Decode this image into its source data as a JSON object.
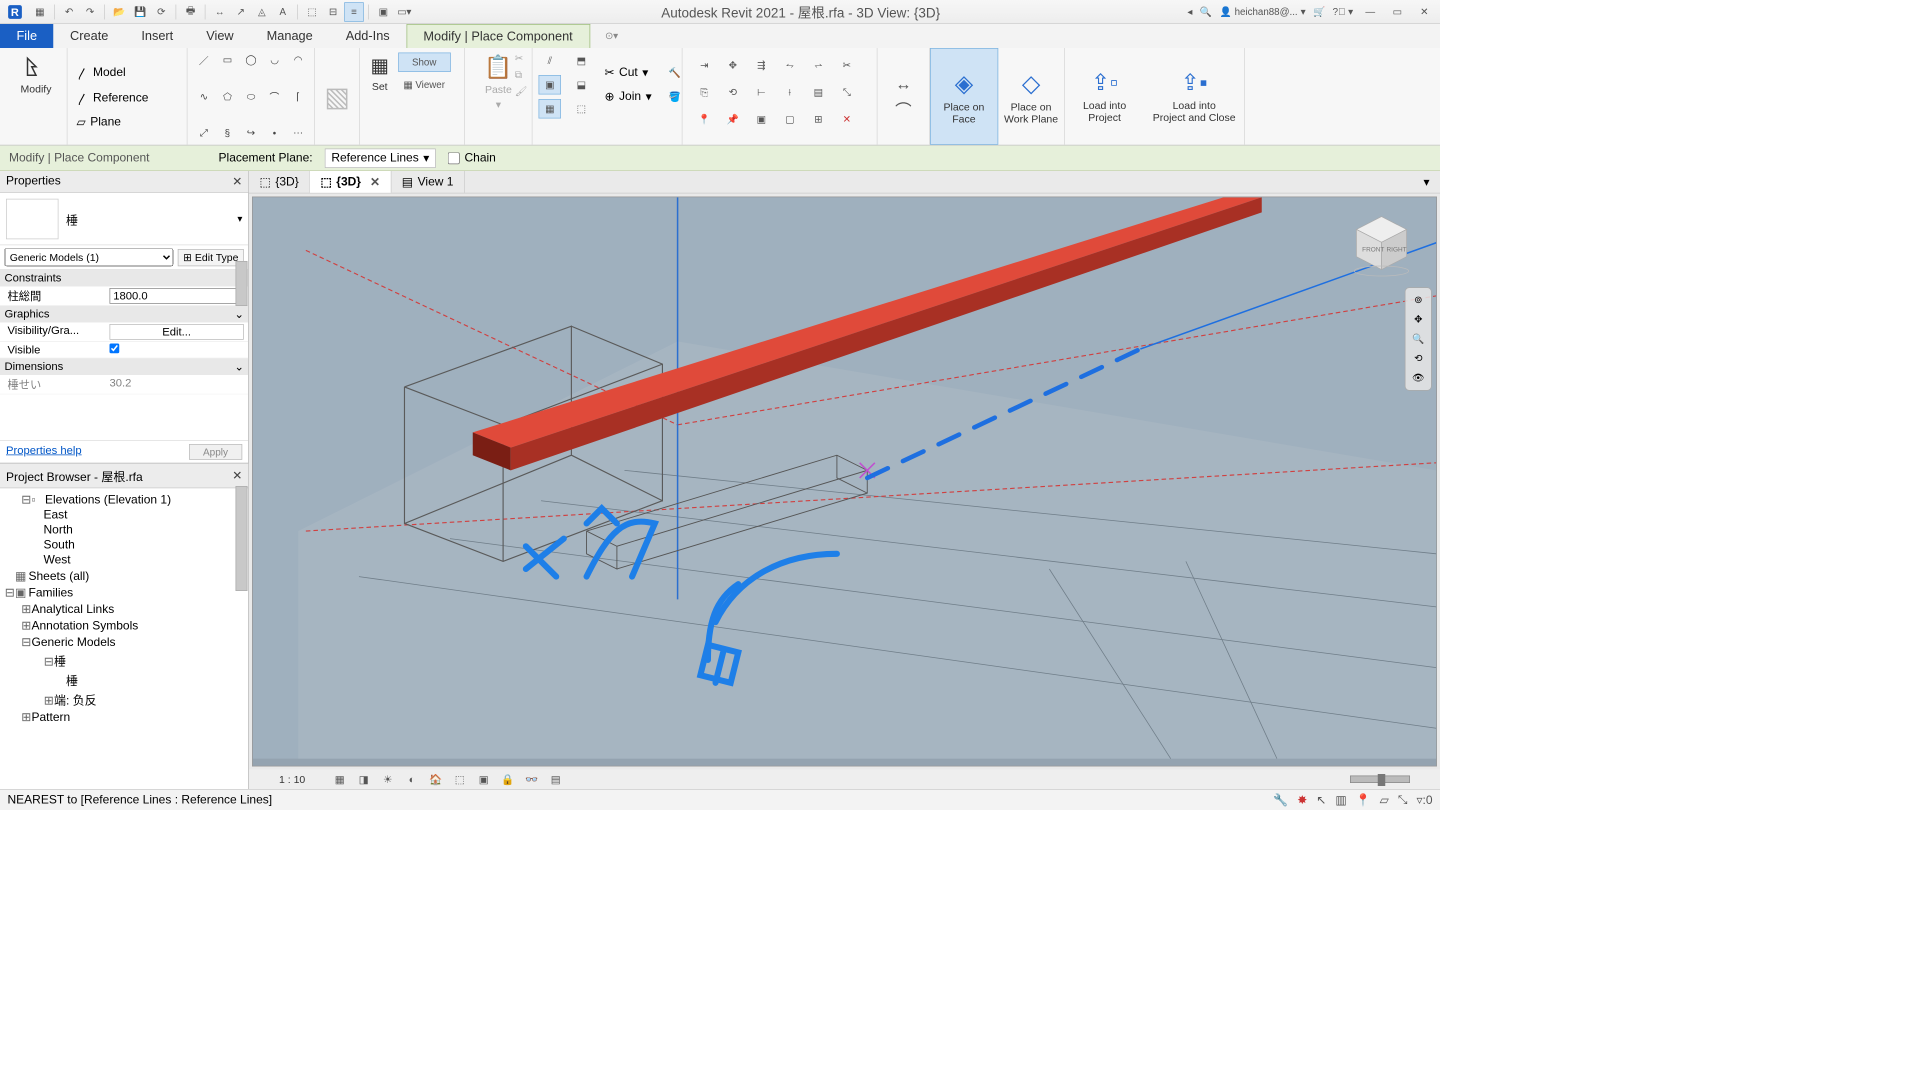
{
  "app": {
    "title": "Autodesk Revit 2021 - 屋根.rfa - 3D View: {3D}",
    "user": "heichan88@...",
    "menu": {
      "file": "File",
      "tabs": [
        "Create",
        "Insert",
        "View",
        "Manage",
        "Add-Ins",
        "Modify | Place Component"
      ],
      "active": 5
    }
  },
  "ribbon": {
    "select": {
      "modify": "Modify"
    },
    "draw_items": [
      "Model",
      "Reference",
      "Plane"
    ],
    "workplane": {
      "set": "Set",
      "show": "Show",
      "viewer": "Viewer"
    },
    "clipboard": {
      "paste": "Paste"
    },
    "geometry": {
      "cut": "Cut",
      "join": "Join"
    },
    "place": {
      "face": "Place on\nFace",
      "plane": "Place on\nWork Plane"
    },
    "load": {
      "project": "Load into\nProject",
      "close": "Load into\nProject and Close"
    }
  },
  "optbar": {
    "label": "Modify | Place Component",
    "plane_label": "Placement Plane:",
    "plane_value": "Reference Lines",
    "chain": "Chain"
  },
  "props": {
    "title": "Properties",
    "type_name": "棰",
    "filter": "Generic Models (1)",
    "edit_type": "Edit Type",
    "groups": {
      "constraints": "Constraints",
      "graphics": "Graphics",
      "dimensions": "Dimensions"
    },
    "rows": {
      "pillar_label": "柱総間",
      "pillar_value": "1800.0",
      "vis_label": "Visibility/Gra...",
      "vis_button": "Edit...",
      "visible_label": "Visible",
      "dim1_label": "棰せい",
      "dim1_value": "30.2"
    },
    "help": "Properties help",
    "apply": "Apply"
  },
  "browser": {
    "title": "Project Browser - 屋根.rfa",
    "nodes": {
      "elev": "Elevations (Elevation 1)",
      "east": "East",
      "north": "North",
      "south": "South",
      "west": "West",
      "sheets": "Sheets (all)",
      "families": "Families",
      "anal": "Analytical Links",
      "anno": "Annotation Symbols",
      "gm": "Generic Models",
      "tr1": "棰",
      "tr2": "棰",
      "tan": "端:  负反",
      "pattern": "Pattern"
    }
  },
  "viewtabs": {
    "t1": "{3D}",
    "t2": "{3D}",
    "t3": "View 1"
  },
  "viewcontrol": {
    "scale": "1 : 10"
  },
  "status": {
    "text": "NEAREST  to [Reference Lines : Reference Lines]",
    "filter": ":0"
  },
  "viewcube": {
    "front": "FRONT",
    "right": "RIGHT"
  }
}
